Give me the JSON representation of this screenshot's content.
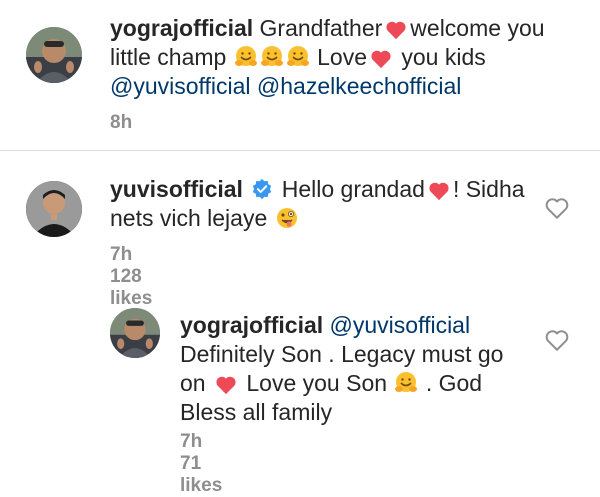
{
  "comments": [
    {
      "username": "yograjofficial",
      "text_1": "Grandfather",
      "text_2": "welcome you",
      "text_3": "little champ",
      "text_4": "Love",
      "text_5": "you kids",
      "mention_1": "@yuvisofficial",
      "mention_2": "@hazelkeechofficial",
      "time": "8h",
      "avatar_icon": "person-avatar-yograj"
    },
    {
      "username": "yuvisofficial",
      "text_1": "Hello grandad",
      "text_2": "! Sidha",
      "text_3": "nets vich lejaye",
      "time": "7h",
      "likes": "128 likes",
      "avatar_icon": "person-avatar-yuvi",
      "verified_icon": "verified-badge-icon"
    },
    {
      "username": "yograjofficial",
      "mention": "@yuvisofficial",
      "text_1": "Definitely Son . Legacy must go",
      "text_2": "on",
      "text_3": "Love you Son",
      "text_4": ". God",
      "text_5": "Bless all family",
      "time": "7h",
      "likes": "71 likes",
      "avatar_icon": "person-avatar-yograj"
    }
  ],
  "colors": {
    "text": "#262626",
    "meta": "#8e8e8e",
    "mention": "#00376b",
    "heart": "#ed4956",
    "verified": "#3897f0",
    "emoji": "#fbc02d"
  }
}
